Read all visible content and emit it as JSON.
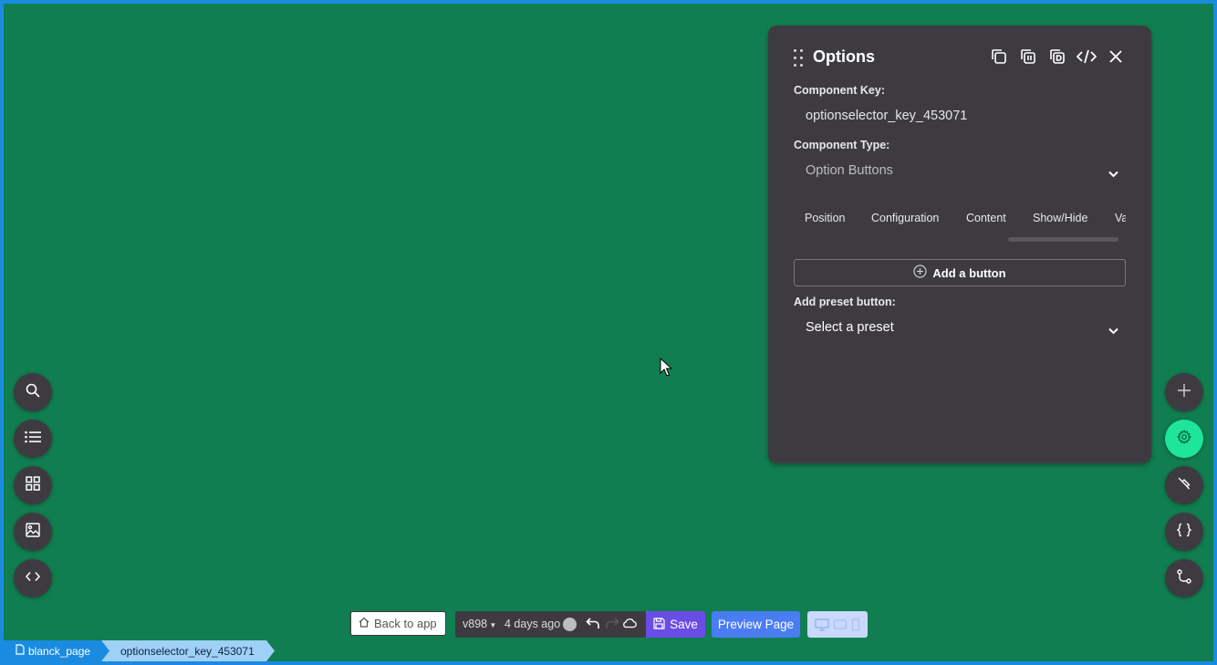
{
  "panel": {
    "title": "Options",
    "header_icons": [
      "copy-icon",
      "copy-component-icon",
      "duplicate-icon",
      "code-icon",
      "close-icon"
    ],
    "component_key_label": "Component Key:",
    "component_key_value": "optionselector_key_453071",
    "component_type_label": "Component Type:",
    "component_type_value": "Option Buttons",
    "tabs": [
      "Position",
      "Configuration",
      "Content",
      "Show/Hide",
      "Va"
    ],
    "add_button_label": "Add a button",
    "preset_label": "Add preset button:",
    "preset_value": "Select a preset"
  },
  "left_toolbar": [
    "search-icon",
    "list-icon",
    "grid-icon",
    "image-icon",
    "code-icon"
  ],
  "right_toolbar": [
    "plus-icon",
    "gear-icon",
    "brush-icon",
    "braces-icon",
    "branch-icon"
  ],
  "bottom_bar": {
    "back_label": "Back to app",
    "version": "v898",
    "time_ago": "4 days ago",
    "save_label": "Save",
    "preview_label": "Preview Page"
  },
  "breadcrumb": [
    "blanck_page",
    "optionselector_key_453071"
  ],
  "colors": {
    "canvas": "#117e51",
    "panel": "#3d3b40",
    "accent_active": "#1ee59a",
    "save": "#6b4de6",
    "preview": "#4a7cf4",
    "breadcrumb": "#1a8be0"
  }
}
